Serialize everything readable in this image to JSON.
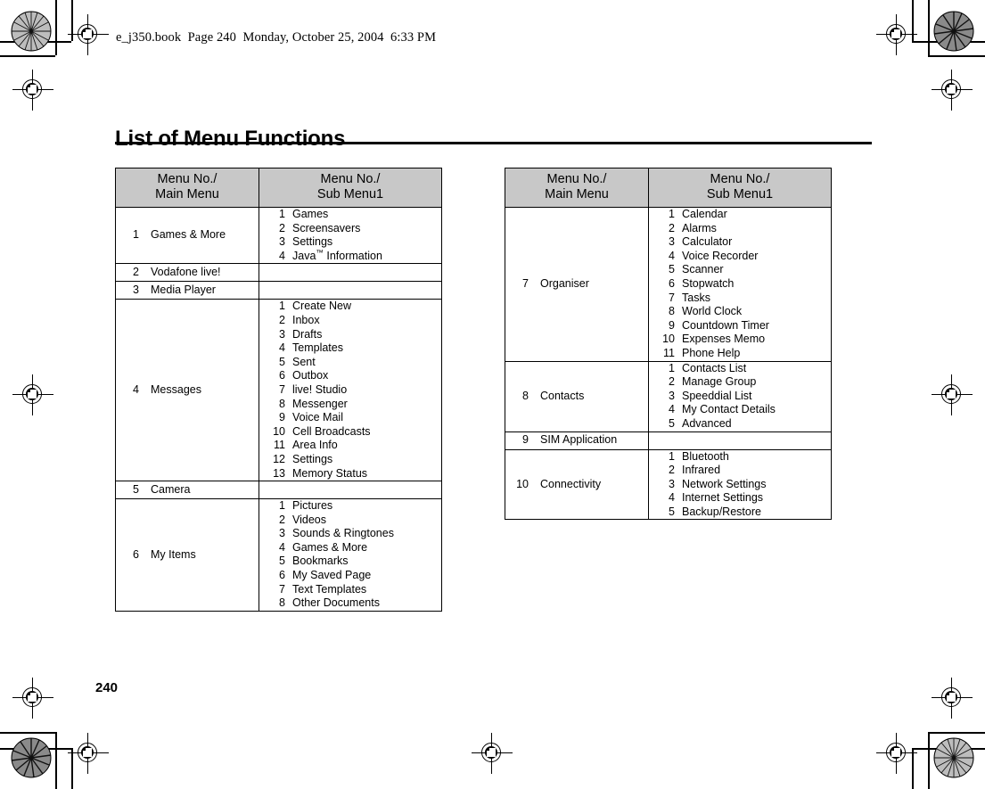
{
  "document": {
    "file_header": "e_j350.book  Page 240  Monday, October 25, 2004  6:33 PM",
    "title": "List of Menu Functions",
    "page_number": "240"
  },
  "colors": {
    "header_gray": "#c8c8c8",
    "rule": "#000000",
    "text": "#000000"
  },
  "tables": [
    {
      "id": "left",
      "headers": {
        "main": "Menu No./\nMain Menu",
        "main_line1": "Menu No./",
        "main_line2": "Main Menu",
        "sub_line1": "Menu No./",
        "sub_line2": "Sub Menu1"
      },
      "rows": [
        {
          "num": "1",
          "label": "Games & More",
          "sub": [
            {
              "num": "1",
              "label": "Games"
            },
            {
              "num": "2",
              "label": "Screensavers"
            },
            {
              "num": "3",
              "label": "Settings"
            },
            {
              "num": "4",
              "label": "Java™ Information"
            }
          ]
        },
        {
          "num": "2",
          "label": "Vodafone live!",
          "sub": []
        },
        {
          "num": "3",
          "label": "Media Player",
          "sub": []
        },
        {
          "num": "4",
          "label": "Messages",
          "sub": [
            {
              "num": "1",
              "label": "Create New"
            },
            {
              "num": "2",
              "label": "Inbox"
            },
            {
              "num": "3",
              "label": "Drafts"
            },
            {
              "num": "4",
              "label": "Templates"
            },
            {
              "num": "5",
              "label": "Sent"
            },
            {
              "num": "6",
              "label": "Outbox"
            },
            {
              "num": "7",
              "label": "live! Studio"
            },
            {
              "num": "8",
              "label": "Messenger"
            },
            {
              "num": "9",
              "label": "Voice Mail"
            },
            {
              "num": "10",
              "label": "Cell Broadcasts"
            },
            {
              "num": "11",
              "label": "Area Info"
            },
            {
              "num": "12",
              "label": "Settings"
            },
            {
              "num": "13",
              "label": "Memory Status"
            }
          ]
        },
        {
          "num": "5",
          "label": "Camera",
          "sub": []
        },
        {
          "num": "6",
          "label": "My Items",
          "sub": [
            {
              "num": "1",
              "label": "Pictures"
            },
            {
              "num": "2",
              "label": "Videos"
            },
            {
              "num": "3",
              "label": "Sounds & Ringtones"
            },
            {
              "num": "4",
              "label": "Games & More"
            },
            {
              "num": "5",
              "label": "Bookmarks"
            },
            {
              "num": "6",
              "label": "My Saved Page"
            },
            {
              "num": "7",
              "label": "Text Templates"
            },
            {
              "num": "8",
              "label": "Other Documents"
            }
          ]
        }
      ]
    },
    {
      "id": "right",
      "headers": {
        "main_line1": "Menu No./",
        "main_line2": "Main Menu",
        "sub_line1": "Menu No./",
        "sub_line2": "Sub Menu1"
      },
      "rows": [
        {
          "num": "7",
          "label": "Organiser",
          "sub": [
            {
              "num": "1",
              "label": "Calendar"
            },
            {
              "num": "2",
              "label": "Alarms"
            },
            {
              "num": "3",
              "label": "Calculator"
            },
            {
              "num": "4",
              "label": "Voice Recorder"
            },
            {
              "num": "5",
              "label": "Scanner"
            },
            {
              "num": "6",
              "label": "Stopwatch"
            },
            {
              "num": "7",
              "label": "Tasks"
            },
            {
              "num": "8",
              "label": "World Clock"
            },
            {
              "num": "9",
              "label": "Countdown Timer"
            },
            {
              "num": "10",
              "label": "Expenses Memo"
            },
            {
              "num": "11",
              "label": "Phone Help"
            }
          ]
        },
        {
          "num": "8",
          "label": "Contacts",
          "sub": [
            {
              "num": "1",
              "label": "Contacts List"
            },
            {
              "num": "2",
              "label": "Manage Group"
            },
            {
              "num": "3",
              "label": "Speeddial List"
            },
            {
              "num": "4",
              "label": "My Contact Details"
            },
            {
              "num": "5",
              "label": "Advanced"
            }
          ]
        },
        {
          "num": "9",
          "label": "SIM Application",
          "sub": []
        },
        {
          "num": "10",
          "label": "Connectivity",
          "sub": [
            {
              "num": "1",
              "label": "Bluetooth"
            },
            {
              "num": "2",
              "label": "Infrared"
            },
            {
              "num": "3",
              "label": "Network Settings"
            },
            {
              "num": "4",
              "label": "Internet Settings"
            },
            {
              "num": "5",
              "label": "Backup/Restore"
            }
          ]
        }
      ]
    }
  ],
  "print_marks": {
    "rosettes": [
      "rosette-top-left",
      "rosette-top-right",
      "rosette-bottom-left",
      "rosette-bottom-right"
    ],
    "crosshairs": [
      "crosshair-top-left-outer",
      "crosshair-top-left-inner",
      "crosshair-top-right-outer",
      "crosshair-top-right-inner",
      "crosshair-mid-left",
      "crosshair-mid-right",
      "crosshair-bottom-left-outer",
      "crosshair-bottom-left-inner",
      "crosshair-bottom-right-outer",
      "crosshair-bottom-right-inner",
      "crosshair-bottom-center"
    ]
  }
}
